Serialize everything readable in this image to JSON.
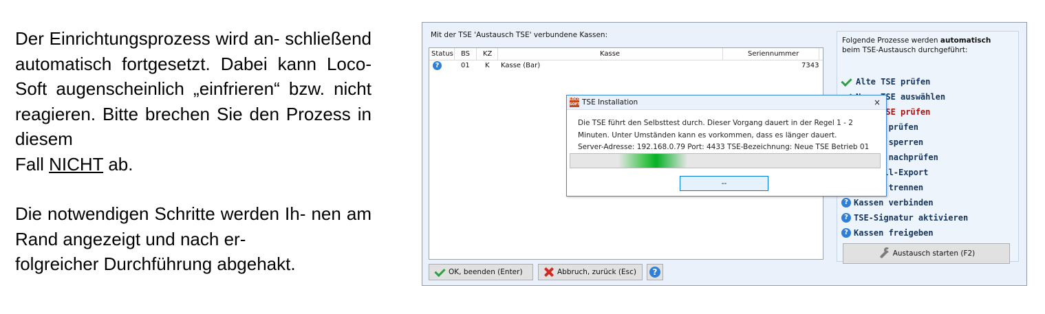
{
  "document": {
    "paragraph1": {
      "lines": [
        "Der Einrichtungsprozess wird an-",
        "schließend automatisch fortgesetzt.",
        "Dabei kann Loco-Soft augenscheinlich",
        "„einfrieren“ bzw. nicht reagieren. Bitte",
        "brechen Sie den Prozess in diesem"
      ],
      "last_line_before": "Fall ",
      "last_line_emphasis": "NICHT",
      "last_line_after": " ab."
    },
    "paragraph2": {
      "lines": [
        "Die notwendigen Schritte werden Ih-",
        "nen am Rand angezeigt und nach er-",
        "folgreicher Durchführung abgehakt."
      ]
    }
  },
  "window": {
    "kassen_title": "Mit der TSE 'Austausch TSE' verbundene Kassen:",
    "table": {
      "columns": [
        "Status",
        "BS",
        "KZ",
        "Kasse",
        "Seriennummer"
      ],
      "rows": [
        {
          "status_icon": "question-icon",
          "bs": "01",
          "kz": "K",
          "kasse": "Kasse (Bar)",
          "seriennummer": "7343"
        }
      ]
    },
    "panel": {
      "intro_pre": "Folgende Prozesse werden ",
      "intro_bold": "automatisch",
      "intro_post": "beim TSE-Austausch durchgeführt:",
      "steps": [
        {
          "label": "Alte TSE prüfen",
          "icon": "check-icon"
        },
        {
          "label": "Neue TSE auswählen",
          "icon": "check-icon"
        },
        {
          "label": "Neue TSE prüfen",
          "icon": "check-icon",
          "highlight": "#a31515"
        },
        {
          "label": "Kassen prüfen",
          "icon": "question-icon"
        },
        {
          "label": "Kassen sperren",
          "icon": "question-icon"
        },
        {
          "label": "Kassen nachprüfen",
          "icon": "question-icon"
        },
        {
          "label": "TSE-Voll-Export",
          "icon": "question-icon"
        },
        {
          "label": "Kassen trennen",
          "icon": "question-icon"
        },
        {
          "label": "Kassen verbinden",
          "icon": "question-icon"
        },
        {
          "label": "TSE-Signatur aktivieren",
          "icon": "question-icon"
        },
        {
          "label": "Kassen freigeben",
          "icon": "question-icon"
        }
      ],
      "start_button": "Austausch starten (F2)"
    },
    "buttons": {
      "ok": "OK, beenden (Enter)",
      "cancel": "Abbruch, zurück (Esc)",
      "help": "?"
    },
    "dialog": {
      "logo_text": "LOCO SOFT",
      "title": "TSE Installation",
      "close": "×",
      "message_line1": "Die TSE führt den Selbsttest durch. Dieser Vorgang dauert in der Regel 1 - 2",
      "message_line2": "Minuten. Unter Umständen kann es vorkommen, dass es länger dauert.",
      "message_line3": "Server-Adresse: 192.168.0.79 Port: 4433 TSE-Bezeichnung: Neue TSE Betrieb 01",
      "button": "--",
      "progress_state": "indeterminate",
      "progress_color": "#06b025"
    }
  }
}
